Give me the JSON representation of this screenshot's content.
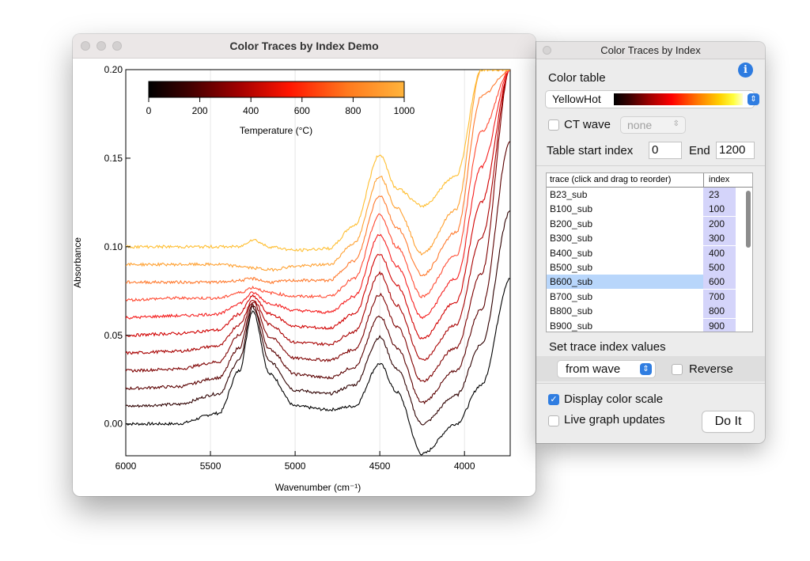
{
  "graph_window": {
    "title": "Color Traces by Index Demo",
    "colorscale": {
      "label": "Temperature (°C)",
      "ticks": [
        "0",
        "200",
        "400",
        "600",
        "800",
        "1000"
      ]
    }
  },
  "panel": {
    "title": "Color Traces by Index",
    "color_table_label": "Color table",
    "color_table_value": "YellowHot",
    "ct_wave_label": "CT wave",
    "ct_wave_value": "none",
    "table_start_label": "Table start index",
    "table_start_value": "0",
    "end_label": "End",
    "end_value": "1200",
    "list_header_trace": "trace (click and drag to reorder)",
    "list_header_index": "index",
    "traces": [
      {
        "name": "B23_sub",
        "index": "23"
      },
      {
        "name": "B100_sub",
        "index": "100"
      },
      {
        "name": "B200_sub",
        "index": "200"
      },
      {
        "name": "B300_sub",
        "index": "300"
      },
      {
        "name": "B400_sub",
        "index": "400"
      },
      {
        "name": "B500_sub",
        "index": "500"
      },
      {
        "name": "B600_sub",
        "index": "600"
      },
      {
        "name": "B700_sub",
        "index": "700"
      },
      {
        "name": "B800_sub",
        "index": "800"
      },
      {
        "name": "B900_sub",
        "index": "900"
      }
    ],
    "selected_trace": "B600_sub",
    "set_index_label": "Set trace index values",
    "from_value": "from wave",
    "reverse_label": "Reverse",
    "reverse_checked": false,
    "display_scale_label": "Display color scale",
    "display_scale_checked": true,
    "live_updates_label": "Live graph updates",
    "live_updates_checked": false,
    "do_it_label": "Do It"
  },
  "chart_data": {
    "type": "line",
    "xlabel": "Wavenumber (cm⁻¹)",
    "ylabel": "Absorbance",
    "xlim": [
      6000,
      3730
    ],
    "x_reversed": true,
    "ylim": [
      -0.018,
      0.2
    ],
    "x_ticks": [
      6000,
      5500,
      5000,
      4500,
      4000
    ],
    "y_ticks": [
      0.0,
      0.05,
      0.1,
      0.15,
      0.2
    ],
    "y_tick_labels": [
      "0.00",
      "0.05",
      "0.10",
      "0.15",
      "0.20"
    ],
    "grid": "vertical",
    "series": [
      {
        "index": 23,
        "color": "#000000",
        "points": [
          [
            6000,
            0.0
          ],
          [
            5700,
            0.0
          ],
          [
            5450,
            0.006
          ],
          [
            5330,
            0.03
          ],
          [
            5250,
            0.064
          ],
          [
            5150,
            0.028
          ],
          [
            5000,
            0.01
          ],
          [
            4800,
            0.008
          ],
          [
            4650,
            0.01
          ],
          [
            4500,
            0.034
          ],
          [
            4400,
            0.018
          ],
          [
            4250,
            -0.017
          ],
          [
            4050,
            0.0
          ],
          [
            3900,
            0.022
          ],
          [
            3730,
            0.082
          ]
        ]
      },
      {
        "index": 100,
        "color": "#2e0000",
        "points": [
          [
            6000,
            0.01
          ],
          [
            5700,
            0.011
          ],
          [
            5450,
            0.017
          ],
          [
            5330,
            0.036
          ],
          [
            5250,
            0.066
          ],
          [
            5150,
            0.035
          ],
          [
            5000,
            0.019
          ],
          [
            4800,
            0.017
          ],
          [
            4650,
            0.022
          ],
          [
            4500,
            0.049
          ],
          [
            4400,
            0.031
          ],
          [
            4250,
            0.0
          ],
          [
            4050,
            0.016
          ],
          [
            3900,
            0.045
          ],
          [
            3730,
            0.12
          ]
        ]
      },
      {
        "index": 200,
        "color": "#5a0000",
        "points": [
          [
            6000,
            0.02
          ],
          [
            5700,
            0.021
          ],
          [
            5450,
            0.026
          ],
          [
            5330,
            0.043
          ],
          [
            5250,
            0.067
          ],
          [
            5150,
            0.042
          ],
          [
            5000,
            0.028
          ],
          [
            4800,
            0.026
          ],
          [
            4650,
            0.032
          ],
          [
            4500,
            0.061
          ],
          [
            4400,
            0.043
          ],
          [
            4250,
            0.012
          ],
          [
            4050,
            0.03
          ],
          [
            3900,
            0.065
          ],
          [
            3730,
            0.16
          ]
        ]
      },
      {
        "index": 300,
        "color": "#7e0000",
        "points": [
          [
            6000,
            0.03
          ],
          [
            5700,
            0.031
          ],
          [
            5450,
            0.035
          ],
          [
            5330,
            0.05
          ],
          [
            5250,
            0.069
          ],
          [
            5150,
            0.049
          ],
          [
            5000,
            0.037
          ],
          [
            4800,
            0.036
          ],
          [
            4650,
            0.042
          ],
          [
            4500,
            0.073
          ],
          [
            4400,
            0.055
          ],
          [
            4250,
            0.024
          ],
          [
            4050,
            0.043
          ],
          [
            3900,
            0.085
          ],
          [
            3730,
            0.2
          ]
        ]
      },
      {
        "index": 400,
        "color": "#a80000",
        "points": [
          [
            6000,
            0.04
          ],
          [
            5700,
            0.041
          ],
          [
            5450,
            0.044
          ],
          [
            5330,
            0.056
          ],
          [
            5250,
            0.07
          ],
          [
            5150,
            0.056
          ],
          [
            5000,
            0.046
          ],
          [
            4800,
            0.045
          ],
          [
            4650,
            0.052
          ],
          [
            4500,
            0.085
          ],
          [
            4400,
            0.067
          ],
          [
            4250,
            0.036
          ],
          [
            4050,
            0.056
          ],
          [
            3900,
            0.105
          ],
          [
            3730,
            0.2
          ]
        ]
      },
      {
        "index": 500,
        "color": "#d10000",
        "points": [
          [
            6000,
            0.05
          ],
          [
            5700,
            0.051
          ],
          [
            5450,
            0.053
          ],
          [
            5330,
            0.062
          ],
          [
            5250,
            0.072
          ],
          [
            5150,
            0.062
          ],
          [
            5000,
            0.055
          ],
          [
            4800,
            0.054
          ],
          [
            4650,
            0.062
          ],
          [
            4500,
            0.096
          ],
          [
            4400,
            0.078
          ],
          [
            4250,
            0.048
          ],
          [
            4050,
            0.069
          ],
          [
            3900,
            0.125
          ],
          [
            3730,
            0.2
          ]
        ]
      },
      {
        "index": 600,
        "color": "#f51e1e",
        "points": [
          [
            6000,
            0.06
          ],
          [
            5700,
            0.061
          ],
          [
            5450,
            0.062
          ],
          [
            5330,
            0.068
          ],
          [
            5250,
            0.074
          ],
          [
            5150,
            0.068
          ],
          [
            5000,
            0.064
          ],
          [
            4800,
            0.063
          ],
          [
            4650,
            0.072
          ],
          [
            4500,
            0.107
          ],
          [
            4400,
            0.089
          ],
          [
            4250,
            0.06
          ],
          [
            4050,
            0.082
          ],
          [
            3900,
            0.145
          ],
          [
            3730,
            0.2
          ]
        ]
      },
      {
        "index": 700,
        "color": "#ff4a32",
        "points": [
          [
            6000,
            0.07
          ],
          [
            5700,
            0.071
          ],
          [
            5450,
            0.071
          ],
          [
            5330,
            0.074
          ],
          [
            5250,
            0.077
          ],
          [
            5150,
            0.074
          ],
          [
            5000,
            0.072
          ],
          [
            4800,
            0.072
          ],
          [
            4650,
            0.082
          ],
          [
            4500,
            0.118
          ],
          [
            4400,
            0.1
          ],
          [
            4250,
            0.072
          ],
          [
            4050,
            0.095
          ],
          [
            3900,
            0.165
          ],
          [
            3730,
            0.2
          ]
        ]
      },
      {
        "index": 800,
        "color": "#ff7a2e",
        "points": [
          [
            6000,
            0.08
          ],
          [
            5700,
            0.08
          ],
          [
            5450,
            0.08
          ],
          [
            5330,
            0.081
          ],
          [
            5250,
            0.082
          ],
          [
            5150,
            0.08
          ],
          [
            5000,
            0.081
          ],
          [
            4800,
            0.081
          ],
          [
            4650,
            0.092
          ],
          [
            4500,
            0.129
          ],
          [
            4400,
            0.111
          ],
          [
            4250,
            0.084
          ],
          [
            4050,
            0.108
          ],
          [
            3900,
            0.185
          ],
          [
            3730,
            0.2
          ]
        ]
      },
      {
        "index": 900,
        "color": "#ffa030",
        "points": [
          [
            6000,
            0.09
          ],
          [
            5700,
            0.09
          ],
          [
            5450,
            0.09
          ],
          [
            5330,
            0.089
          ],
          [
            5250,
            0.088
          ],
          [
            5150,
            0.087
          ],
          [
            5000,
            0.089
          ],
          [
            4800,
            0.09
          ],
          [
            4650,
            0.102
          ],
          [
            4500,
            0.14
          ],
          [
            4400,
            0.122
          ],
          [
            4250,
            0.096
          ],
          [
            4050,
            0.121
          ],
          [
            3900,
            0.2
          ],
          [
            3730,
            0.2
          ]
        ]
      },
      {
        "index": 1000,
        "color": "#ffbe30",
        "points": [
          [
            6000,
            0.1
          ],
          [
            5700,
            0.1
          ],
          [
            5450,
            0.1
          ],
          [
            5330,
            0.1
          ],
          [
            5250,
            0.104
          ],
          [
            5150,
            0.1
          ],
          [
            5000,
            0.098
          ],
          [
            4800,
            0.099
          ],
          [
            4650,
            0.112
          ],
          [
            4500,
            0.152
          ],
          [
            4400,
            0.133
          ],
          [
            4250,
            0.123
          ],
          [
            4050,
            0.14
          ],
          [
            3900,
            0.2
          ],
          [
            3730,
            0.2
          ]
        ]
      }
    ]
  }
}
